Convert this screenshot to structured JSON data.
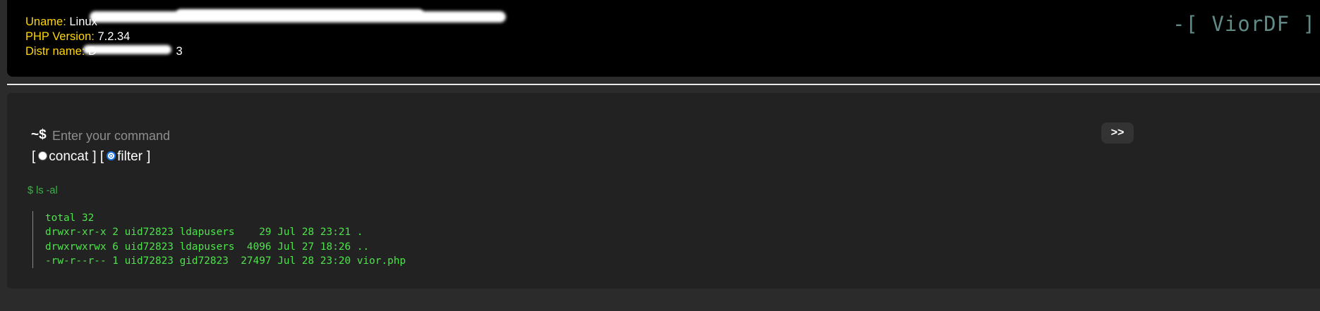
{
  "header": {
    "uname_label": "Uname:",
    "uname_value": "Linux ",
    "php_label": "PHP Version:",
    "php_value": "7.2.34",
    "distr_label": "Distr name:",
    "distr_value": "D",
    "distr_value_tail": "3",
    "brand": "-[ ViorDF ]"
  },
  "console": {
    "prompt": "~$",
    "input_placeholder": "Enter your command",
    "input_value": "",
    "run_label": ">>",
    "option_concat": "concat",
    "option_filter": "filter",
    "selected_option": "filter",
    "last_command": "$ ls -al",
    "output_lines": [
      "total 32",
      "drwxr-xr-x 2 uid72823 ldapusers    29 Jul 28 23:21 .",
      "drwxrwxrwx 6 uid72823 ldapusers  4096 Jul 27 18:26 ..",
      "-rw-r--r-- 1 uid72823 gid72823  27497 Jul 28 23:20 vior.php"
    ]
  },
  "colors": {
    "label": "#ffd700",
    "brand": "#5f8a86",
    "output": "#4fe24c",
    "command": "#3fb04a"
  }
}
